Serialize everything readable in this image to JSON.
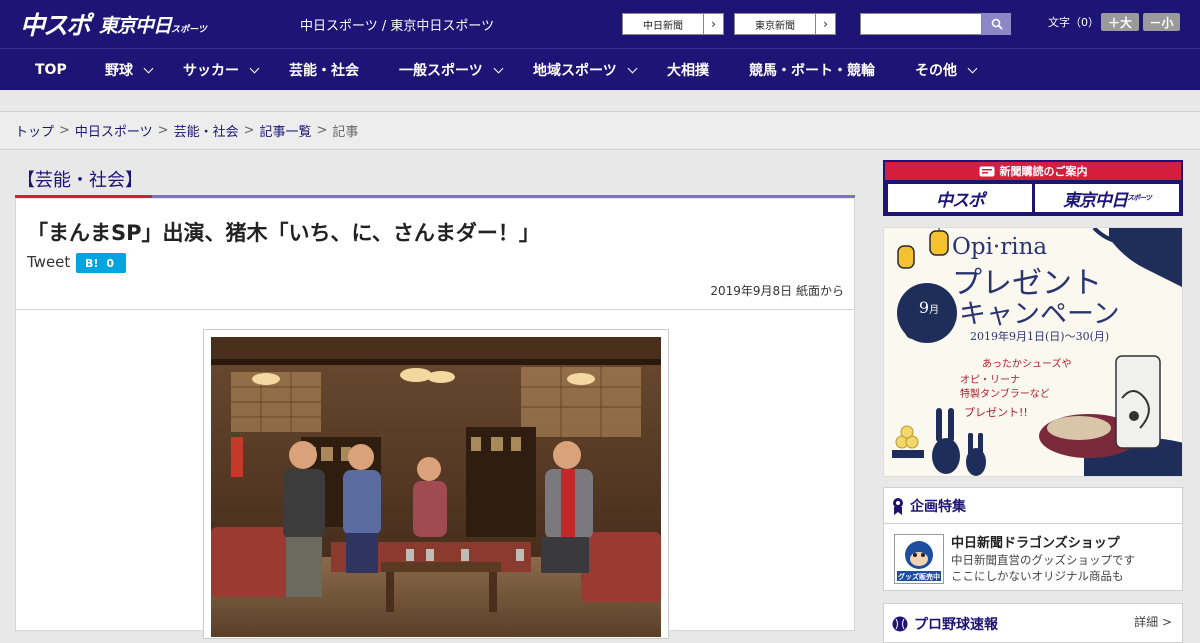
{
  "header": {
    "logo_main": "中スポ",
    "logo_sub": "東京中日",
    "logo_sub_small": "スポーツ",
    "tagline": "中日スポーツ / 東京中日スポーツ",
    "site_links": [
      {
        "label": "中日新聞"
      },
      {
        "label": "東京新聞"
      }
    ],
    "search": {
      "placeholder": ""
    },
    "fontsize_label": "文字（0）",
    "font_larger": "＋大",
    "font_smaller": "－小"
  },
  "nav": {
    "items": [
      {
        "label": "TOP"
      },
      {
        "label": "野球"
      },
      {
        "label": "サッカー"
      },
      {
        "label": "芸能・社会"
      },
      {
        "label": "一般スポーツ"
      },
      {
        "label": "地域スポーツ"
      },
      {
        "label": "大相撲"
      },
      {
        "label": "競馬・ボート・競輪"
      },
      {
        "label": "その他"
      }
    ]
  },
  "breadcrumb": {
    "items": [
      "トップ",
      "中日スポーツ",
      "芸能・社会",
      "記事一覧"
    ],
    "current": "記事",
    "separator": ">"
  },
  "article": {
    "section": "【芸能・社会】",
    "headline": "「まんまSP」出演、猪木「いち、に、さんまダー！」",
    "tweet_label": "Tweet",
    "hatena_label": "B!",
    "hatena_count": "0",
    "date": "2019年9月8日 紙面から"
  },
  "sidebar": {
    "subscribe_title": "新聞購読のご案内",
    "subscribe_logo1": "中スポ",
    "subscribe_logo2": "東京中日",
    "subscribe_logo2_small": "スポーツ",
    "banner": {
      "brand": "Opi·rina",
      "title_line1": "プレゼント",
      "title_line2": "キャンペーン",
      "month": "9",
      "month_unit": "月",
      "period": "2019年9月1日(日)〜30(月)",
      "copy1": "あったかシューズや",
      "copy2": "オピ・リーナ",
      "copy3": "特製タンブラーなど",
      "copy4": "プレゼント!!"
    },
    "feature": {
      "heading": "企画特集",
      "title": "中日新聞ドラゴンズショップ",
      "desc1": "中日新聞直営のグッズショップです",
      "desc2": "ここにしかないオリジナル商品も",
      "thumb_label": "グッズ販売中"
    },
    "baseball": {
      "heading": "プロ野球速報",
      "more": "詳細 >"
    }
  },
  "colors": {
    "brand_navy": "#1d1475",
    "accent_red": "#d41e3c",
    "section_purple": "#7b72c0",
    "hatena_blue": "#00a4de"
  }
}
